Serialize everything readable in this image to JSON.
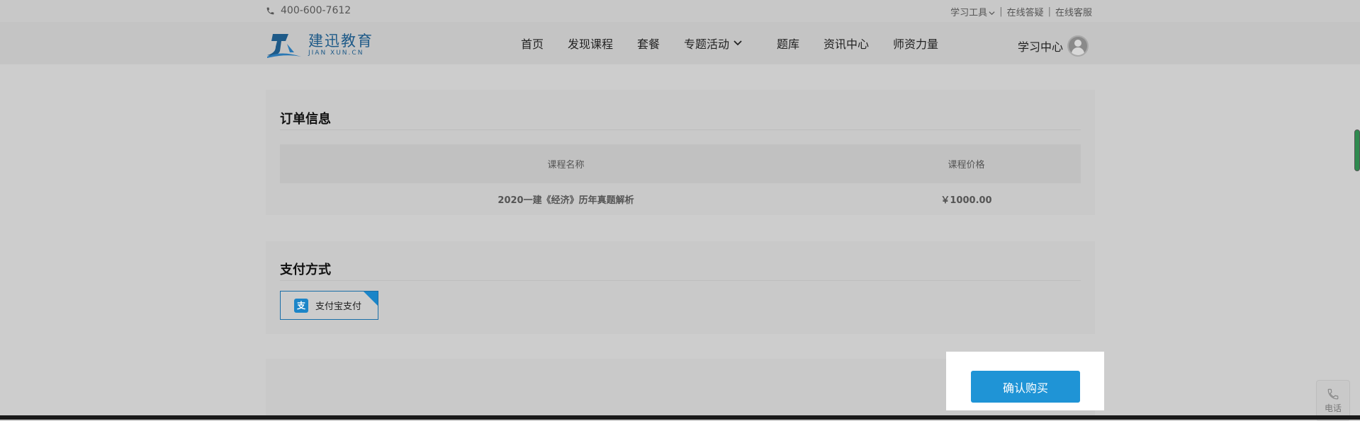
{
  "topbar": {
    "phone": "400-600-7612",
    "links": [
      "学习工具",
      "在线答疑",
      "在线客服"
    ]
  },
  "logo": {
    "name_cn": "建迅教育",
    "name_en": "JIAN XUN.CN"
  },
  "nav": {
    "items": [
      "首页",
      "发现课程",
      "套餐",
      "专题活动",
      "题库",
      "资讯中心",
      "师资力量"
    ],
    "learn_center": "学习中心"
  },
  "order": {
    "title": "订单信息",
    "columns": [
      "课程名称",
      "课程价格"
    ],
    "rows": [
      {
        "course": "2020一建《经济》历年真题解析",
        "price": "￥1000.00"
      }
    ]
  },
  "payment": {
    "title": "支付方式",
    "method": "支付宝支付",
    "method_icon": "alipay-icon",
    "accent": "#1b85c8"
  },
  "confirm_label": "确认购买",
  "side": {
    "phone_label": "电话"
  }
}
